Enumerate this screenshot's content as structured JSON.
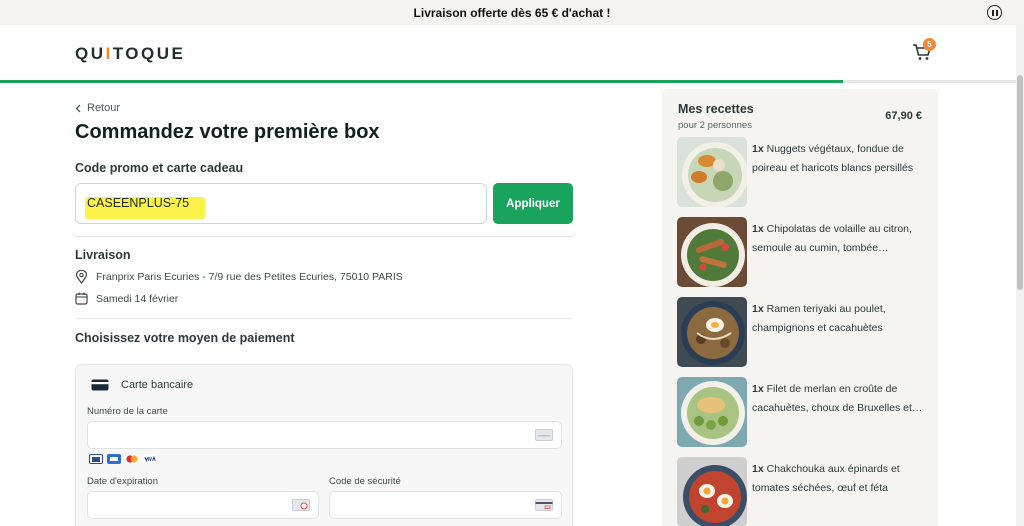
{
  "promo_bar": {
    "text": "Livraison offerte dès 65 € d'achat !"
  },
  "header": {
    "logo": {
      "part1": "QU",
      "part2": "I",
      "part3": "TOQUE"
    },
    "cart_count": "5"
  },
  "progress": {
    "fraction": 0.83,
    "color": "#18a35a"
  },
  "back": {
    "label": "Retour"
  },
  "page": {
    "title": "Commandez votre première box"
  },
  "promo": {
    "section_label": "Code promo et carte cadeau",
    "value": "CASEENPLUS-75",
    "apply_label": "Appliquer"
  },
  "delivery": {
    "section_label": "Livraison",
    "address": "Franprix Paris Ecuries - 7/9 rue des Petites Ecuries, 75010 PARIS",
    "date": "Samedi 14 février"
  },
  "payment": {
    "section_label": "Choisissez votre moyen de paiement",
    "method_label": "Carte bancaire",
    "card_number_label": "Numéro de la carte",
    "expiry_label": "Date d'expiration",
    "cvc_label": "Code de sécurité"
  },
  "recipes": {
    "title": "Mes recettes",
    "subtitle": "pour 2 personnes",
    "total": "67,90 €",
    "items": [
      {
        "qty": "1x",
        "name": "Nuggets végétaux, fondue de poireau et haricots blancs persillés"
      },
      {
        "qty": "1x",
        "name": "Chipolatas de volaille au citron, semoule au cumin, tombée…"
      },
      {
        "qty": "1x",
        "name": "Ramen teriyaki au poulet, champignons et cacahuètes"
      },
      {
        "qty": "1x",
        "name": "Filet de merlan en croûte de cacahuètes, choux de Bruxelles et…"
      },
      {
        "qty": "1x",
        "name": "Chakchouka aux épinards et tomates séchées, œuf et féta"
      }
    ]
  },
  "colors": {
    "accent": "#1aa35c",
    "badge": "#f08a3a",
    "highlight": "#fbf24a"
  }
}
